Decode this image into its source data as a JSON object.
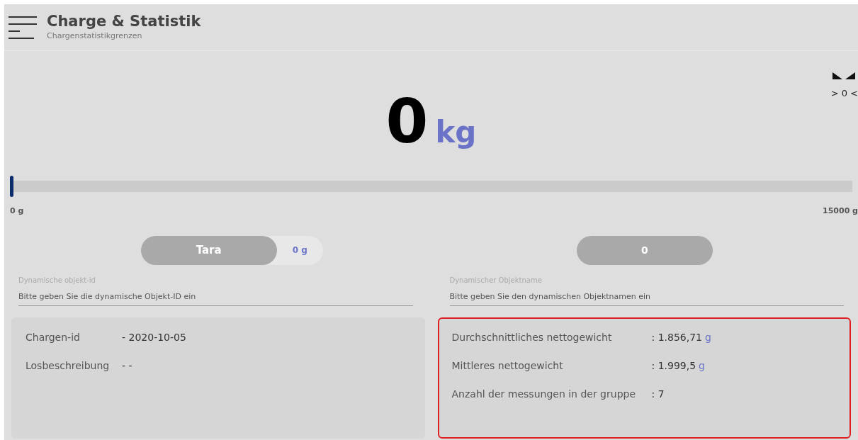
{
  "header": {
    "title": "Charge & Statistik",
    "subtitle": "Chargenstatistikgrenzen"
  },
  "weight": {
    "value": "0",
    "unit": "kg"
  },
  "zero_indicator": {
    "label": "> 0 <"
  },
  "scale_bar": {
    "level": 0,
    "min_label": "0 g",
    "max_label": "15000 g"
  },
  "tare": {
    "label": "Tara",
    "value": "0 g"
  },
  "counter": {
    "label": "0"
  },
  "fields": [
    {
      "label": "Dynamische objekt-id",
      "placeholder": "Bitte geben Sie die dynamische Objekt-ID ein"
    },
    {
      "label": "Dynamischer Objektname",
      "placeholder": "Bitte geben Sie den dynamischen Objektnamen ein"
    }
  ],
  "batch_panel": {
    "highlighted": false,
    "rows": [
      {
        "label": "Chargen-id",
        "value": "- 2020-10-05"
      },
      {
        "label": "Losbeschreibung",
        "value": "- -"
      }
    ]
  },
  "stats_panel": {
    "highlighted": true,
    "rows": [
      {
        "label": "Durchschnittliches nettogewicht",
        "value": ": 1.856,71",
        "unit": "g"
      },
      {
        "label": "Mittleres nettogewicht",
        "value": ": 1.999,5",
        "unit": "g"
      },
      {
        "label": "Anzahl der messungen in der gruppe",
        "value": ": 7"
      }
    ]
  }
}
